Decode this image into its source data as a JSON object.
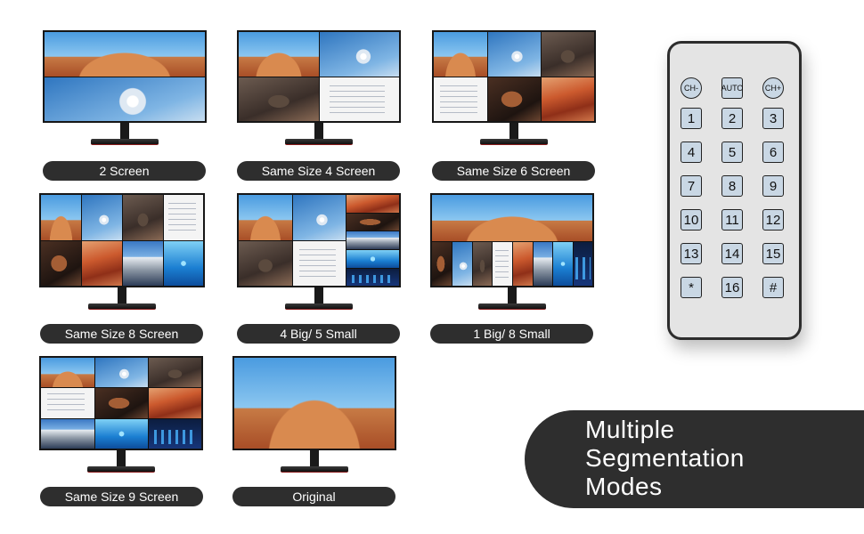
{
  "modes": [
    {
      "id": "2-screen",
      "label": "2 Screen"
    },
    {
      "id": "same-size-4",
      "label": "Same Size 4 Screen"
    },
    {
      "id": "same-size-6",
      "label": "Same Size 6 Screen"
    },
    {
      "id": "same-size-8",
      "label": "Same Size 8 Screen"
    },
    {
      "id": "4big-5small",
      "label": "4 Big/ 5 Small"
    },
    {
      "id": "1big-8small",
      "label": "1 Big/ 8 Small"
    },
    {
      "id": "same-size-9",
      "label": "Same Size 9 Screen"
    },
    {
      "id": "original",
      "label": "Original"
    }
  ],
  "remote": {
    "top_row": [
      "CH-",
      "AUTO",
      "CH+"
    ],
    "keys": [
      "1",
      "2",
      "3",
      "4",
      "5",
      "6",
      "7",
      "8",
      "9",
      "10",
      "11",
      "12",
      "13",
      "14",
      "15",
      "*",
      "16",
      "#"
    ]
  },
  "banner": {
    "line1": "Multiple",
    "line2": "Segmentation",
    "line3": "Modes"
  },
  "colors": {
    "label_bg": "#2e2e2e",
    "label_text": "#ffffff",
    "remote_button": "#c9d7e4"
  }
}
